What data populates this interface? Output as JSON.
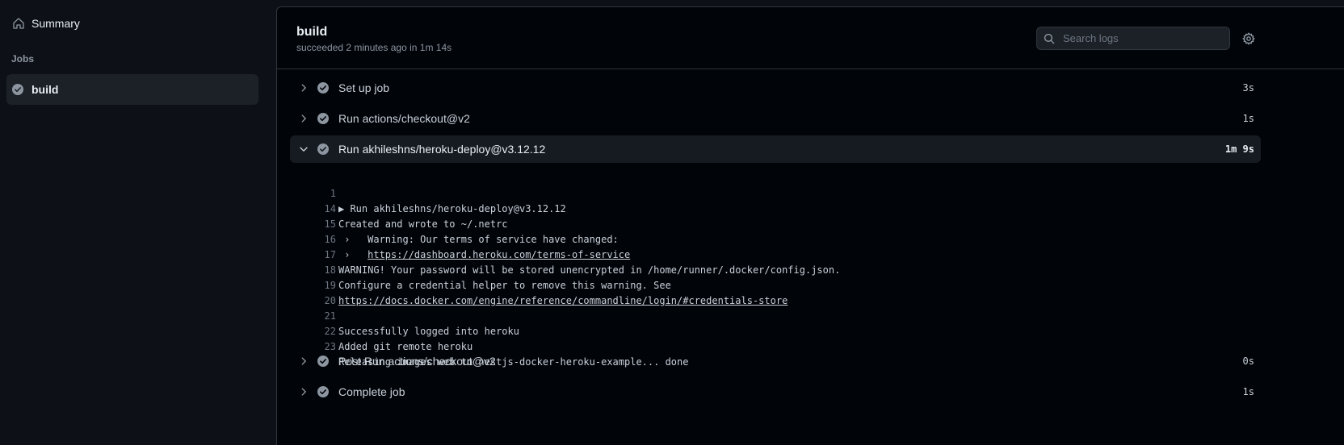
{
  "sidebar": {
    "summary_label": "Summary",
    "jobs_heading": "Jobs",
    "job_label": "build"
  },
  "header": {
    "title": "build",
    "subtitle": "succeeded 2 minutes ago in 1m 14s",
    "search_placeholder": "Search logs"
  },
  "steps": [
    {
      "name": "Set up job",
      "duration": "3s"
    },
    {
      "name": "Run actions/checkout@v2",
      "duration": "1s"
    },
    {
      "name": "Run akhileshns/heroku-deploy@v3.12.12",
      "duration": "1m 9s"
    },
    {
      "name": "Post Run actions/checkout@v2",
      "duration": "0s"
    },
    {
      "name": "Complete job",
      "duration": "1s"
    }
  ],
  "log_lines": [
    {
      "num": "1",
      "text": "▶ Run akhileshns/heroku-deploy@v3.12.12"
    },
    {
      "num": "14",
      "text": "Created and wrote to ~/.netrc"
    },
    {
      "num": "15",
      "text": " ›   Warning: Our terms of service have changed:"
    },
    {
      "num": "16",
      "prefix": " ›   ",
      "link": "https://dashboard.heroku.com/terms-of-service"
    },
    {
      "num": "17",
      "text": "WARNING! Your password will be stored unencrypted in /home/runner/.docker/config.json."
    },
    {
      "num": "18",
      "text": "Configure a credential helper to remove this warning. See"
    },
    {
      "num": "19",
      "link": "https://docs.docker.com/engine/reference/commandline/login/#credentials-store"
    },
    {
      "num": "20",
      "text": ""
    },
    {
      "num": "21",
      "text": "Successfully logged into heroku"
    },
    {
      "num": "22",
      "text": "Added git remote heroku"
    },
    {
      "num": "23",
      "text": "Releasing images web to nestjs-docker-heroku-example... done"
    }
  ],
  "colors": {
    "background": "#0d1117",
    "panel": "#010409",
    "text": "#e6edf3",
    "muted": "#8d96a0",
    "check": "#8d96a0"
  }
}
